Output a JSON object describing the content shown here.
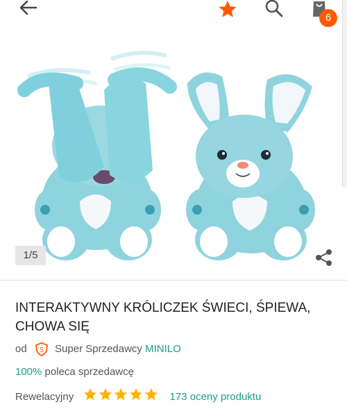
{
  "header": {
    "back_icon": "arrow-left-icon",
    "favorite_icon": "star-icon",
    "search_icon": "search-icon",
    "cart_icon": "shopping-bag-icon",
    "cart_count": "6",
    "accent_color": "#ff5a00"
  },
  "gallery": {
    "counter": "1/5",
    "share_icon": "share-icon"
  },
  "product": {
    "title": "INTERAKTYWNY KRÓLICZEK ŚWIECI, ŚPIEWA, CHOWA SIĘ",
    "seller_prefix": "od",
    "seller_badge_icon": "super-seller-shield-icon",
    "seller_label": "Super Sprzedawcy",
    "seller_name": "MINILO",
    "recommend_pct": "100%",
    "recommend_text": "poleca sprzedawcę",
    "rating_label": "Rewelacyjny",
    "rating_stars": 5,
    "rating_count_text": "173 oceny produktu",
    "link_color": "#1b9e8f",
    "star_color": "#ffb000"
  }
}
